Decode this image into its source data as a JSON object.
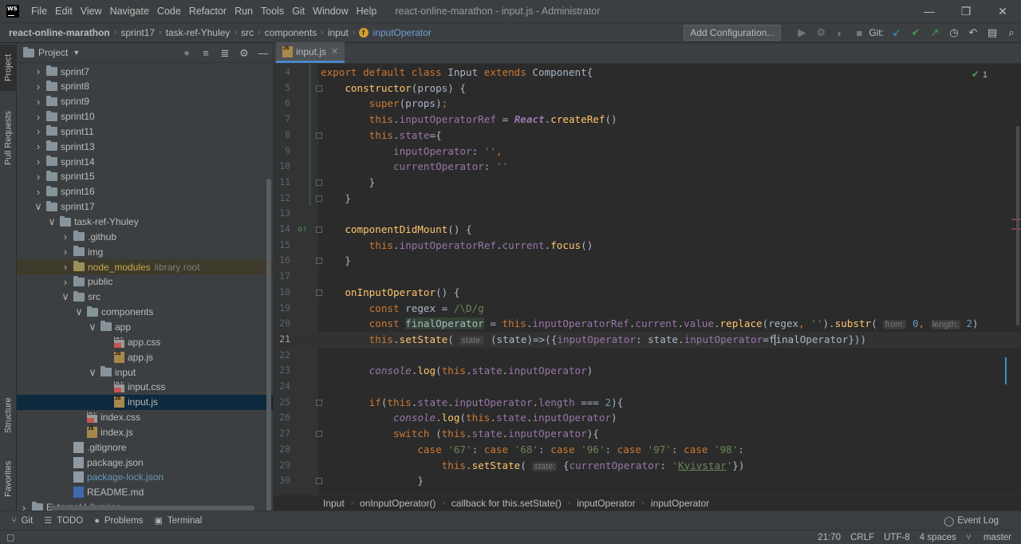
{
  "window": {
    "logo_text": "WS",
    "menu": [
      "File",
      "Edit",
      "View",
      "Navigate",
      "Code",
      "Refactor",
      "Run",
      "Tools",
      "Git",
      "Window",
      "Help"
    ],
    "title": "react-online-marathon - input.js - Administrator"
  },
  "nav": {
    "crumbs": [
      "react-online-marathon",
      "sprint17",
      "task-ref-Yhuley",
      "src",
      "components",
      "input"
    ],
    "function": "inputOperator",
    "add_config": "Add Configuration...",
    "git_label": "Git:"
  },
  "left_strip": {
    "project": "Project",
    "pull_requests": "Pull Requests",
    "structure": "Structure",
    "favorites": "Favorites"
  },
  "project_panel": {
    "title": "Project",
    "tree": [
      {
        "indent": 0,
        "arrow": "›",
        "type": "folder",
        "name": "sprint7"
      },
      {
        "indent": 0,
        "arrow": "›",
        "type": "folder",
        "name": "sprint8"
      },
      {
        "indent": 0,
        "arrow": "›",
        "type": "folder",
        "name": "sprint9"
      },
      {
        "indent": 0,
        "arrow": "›",
        "type": "folder",
        "name": "sprint10"
      },
      {
        "indent": 0,
        "arrow": "›",
        "type": "folder",
        "name": "sprint11"
      },
      {
        "indent": 0,
        "arrow": "›",
        "type": "folder",
        "name": "sprint13"
      },
      {
        "indent": 0,
        "arrow": "›",
        "type": "folder",
        "name": "sprint14"
      },
      {
        "indent": 0,
        "arrow": "›",
        "type": "folder",
        "name": "sprint15"
      },
      {
        "indent": 0,
        "arrow": "›",
        "type": "folder",
        "name": "sprint16"
      },
      {
        "indent": 0,
        "arrow": "⌄",
        "type": "folder",
        "name": "sprint17"
      },
      {
        "indent": 1,
        "arrow": "⌄",
        "type": "folder",
        "name": "task-ref-Yhuley"
      },
      {
        "indent": 2,
        "arrow": "›",
        "type": "folder",
        "name": ".github"
      },
      {
        "indent": 2,
        "arrow": "›",
        "type": "folder",
        "name": "img"
      },
      {
        "indent": 2,
        "arrow": "›",
        "type": "libfolder",
        "name": "node_modules",
        "extra": "library root"
      },
      {
        "indent": 2,
        "arrow": "›",
        "type": "folder",
        "name": "public"
      },
      {
        "indent": 2,
        "arrow": "⌄",
        "type": "folder",
        "name": "src"
      },
      {
        "indent": 3,
        "arrow": "⌄",
        "type": "folder",
        "name": "components"
      },
      {
        "indent": 4,
        "arrow": "⌄",
        "type": "folder",
        "name": "app"
      },
      {
        "indent": 5,
        "arrow": "",
        "type": "css",
        "name": "app.css"
      },
      {
        "indent": 5,
        "arrow": "",
        "type": "js",
        "name": "app.js"
      },
      {
        "indent": 4,
        "arrow": "⌄",
        "type": "folder",
        "name": "input"
      },
      {
        "indent": 5,
        "arrow": "",
        "type": "css",
        "name": "input.css"
      },
      {
        "indent": 5,
        "arrow": "",
        "type": "js",
        "name": "input.js",
        "selected": true
      },
      {
        "indent": 3,
        "arrow": "",
        "type": "css",
        "name": "index.css"
      },
      {
        "indent": 3,
        "arrow": "",
        "type": "js",
        "name": "index.js"
      },
      {
        "indent": 2,
        "arrow": "",
        "type": "git",
        "name": ".gitignore"
      },
      {
        "indent": 2,
        "arrow": "",
        "type": "json",
        "name": "package.json"
      },
      {
        "indent": 2,
        "arrow": "",
        "type": "json",
        "name": "package-lock.json",
        "blue": true
      },
      {
        "indent": 2,
        "arrow": "",
        "type": "md",
        "name": "README.md"
      },
      {
        "indent": -1,
        "arrow": "›",
        "type": "extlib",
        "name": "External Libraries"
      }
    ]
  },
  "editor": {
    "tab_label": "input.js",
    "inspection_count": "1",
    "breadcrumbs": [
      "Input",
      "onInputOperator()",
      "callback for this.setState()",
      "inputOperator",
      "inputOperator"
    ],
    "current_line": 21,
    "lines": [
      {
        "n": 4,
        "html": "<span class='kw'>export default class </span><span class='cls'>Input </span><span class='kw'>extends </span><span class='cls'>Component</span><span class='plain'>{</span>"
      },
      {
        "n": 5,
        "html": "    <span class='fn'>constructor</span><span class='plain'>(props) {</span>"
      },
      {
        "n": 6,
        "html": "        <span class='kw'>super</span><span class='plain'>(props)</span><span class='kw'>;</span>"
      },
      {
        "n": 7,
        "html": "        <span class='kw'>this</span><span class='plain'>.</span><span class='fld'>inputOperatorRef</span><span class='plain'> = </span><span class='ital'>React</span><span class='plain'>.</span><span class='fn'>createRef</span><span class='plain'>()</span>"
      },
      {
        "n": 8,
        "html": "        <span class='kw'>this</span><span class='plain'>.</span><span class='fld'>state</span><span class='plain'>={</span>"
      },
      {
        "n": 9,
        "html": "            <span class='fld'>inputOperator</span><span class='plain'>: </span><span class='str'>''</span><span class='kw'>,</span>"
      },
      {
        "n": 10,
        "html": "            <span class='fld'>currentOperator</span><span class='plain'>: </span><span class='str'>''</span>"
      },
      {
        "n": 11,
        "html": "        <span class='plain'>}</span>"
      },
      {
        "n": 12,
        "html": "    <span class='plain'>}</span>"
      },
      {
        "n": 13,
        "html": ""
      },
      {
        "n": 14,
        "html": "    <span class='fn'>componentDidMount</span><span class='plain'>() {</span>"
      },
      {
        "n": 15,
        "html": "        <span class='kw'>this</span><span class='plain'>.</span><span class='fld'>inputOperatorRef</span><span class='plain'>.</span><span class='fld'>current</span><span class='plain'>.</span><span class='fn'>focus</span><span class='plain'>()</span>"
      },
      {
        "n": 16,
        "html": "    <span class='plain'>}</span>"
      },
      {
        "n": 17,
        "html": ""
      },
      {
        "n": 18,
        "html": "    <span class='fn'>onInputOperator</span><span class='plain'>() {</span>"
      },
      {
        "n": 19,
        "html": "        <span class='kw'>const </span><span class='plain'>regex = </span><span class='str'>/\\D/g</span>"
      },
      {
        "n": 20,
        "html": "        <span class='kw'>const </span><span class='plain hl-var'>finalOperator</span><span class='plain'> = </span><span class='kw'>this</span><span class='plain'>.</span><span class='fld'>inputOperatorRef</span><span class='plain'>.</span><span class='fld'>current</span><span class='plain'>.</span><span class='fld'>value</span><span class='plain'>.</span><span class='fn'>replace</span><span class='plain'>(regex</span><span class='kw'>, </span><span class='str'>''</span><span class='plain'>).</span><span class='fn'>substr</span><span class='plain'>( </span><span class='param-hint'>from:</span><span class='num'> 0</span><span class='kw'>, </span><span class='param-hint'>length:</span><span class='num'> 2</span><span class='plain'>)</span>"
      },
      {
        "n": 21,
        "html": "        <span class='kw'>this</span><span class='plain'>.</span><span class='fn'>setState</span><span class='plain'>( </span><span class='param-hint'>state:</span><span class='plain'> (state)=>({</span><span class='fld'>inputOperator</span><span class='plain'>: state.</span><span class='fld'>inputOperator</span><span class='plain'>=f</span><span class='caret'></span><span class='plain'>inalOperator})</span><span class='plain'>)</span>"
      },
      {
        "n": 22,
        "html": ""
      },
      {
        "n": 23,
        "html": "        <span class='ital' style='font-weight:normal'>console</span><span class='plain'>.</span><span class='fn'>log</span><span class='plain'>(</span><span class='kw'>this</span><span class='plain'>.</span><span class='fld'>state</span><span class='plain'>.</span><span class='fld'>inputOperator</span><span class='plain'>)</span>"
      },
      {
        "n": 24,
        "html": ""
      },
      {
        "n": 25,
        "html": "        <span class='kw'>if</span><span class='plain'>(</span><span class='kw'>this</span><span class='plain'>.</span><span class='fld'>state</span><span class='plain'>.</span><span class='fld'>inputOperator</span><span class='plain'>.</span><span class='fld'>length</span><span class='plain'> === </span><span class='num'>2</span><span class='plain'>){</span>"
      },
      {
        "n": 26,
        "html": "            <span class='ital' style='font-weight:normal'>console</span><span class='plain'>.</span><span class='fn'>log</span><span class='plain'>(</span><span class='kw'>this</span><span class='plain'>.</span><span class='fld'>state</span><span class='plain'>.</span><span class='fld'>inputOperator</span><span class='plain'>)</span>"
      },
      {
        "n": 27,
        "html": "            <span class='kw'>switch </span><span class='plain'>(</span><span class='kw'>this</span><span class='plain'>.</span><span class='fld'>state</span><span class='plain'>.</span><span class='fld'>inputOperator</span><span class='plain'>){</span>"
      },
      {
        "n": 28,
        "html": "                <span class='kw'>case </span><span class='str'>'67'</span><span class='plain'>: </span><span class='kw'>case </span><span class='str'>'68'</span><span class='plain'>: </span><span class='kw'>case </span><span class='str'>'96'</span><span class='plain'>: </span><span class='kw'>case </span><span class='str'>'97'</span><span class='plain'>: </span><span class='kw'>case </span><span class='str'>'98'</span><span class='plain'>:</span>"
      },
      {
        "n": 29,
        "html": "                    <span class='kw'>this</span><span class='plain'>.</span><span class='fn'>setState</span><span class='plain'>( </span><span class='param-hint'>state:</span><span class='plain'> {</span><span class='fld'>currentOperator</span><span class='plain'>: </span><span class='str'>'<span class=\"under\">Kyivstar</span>'</span><span class='plain'>})</span>"
      },
      {
        "n": 30,
        "html": "                <span class='plain'>}</span>"
      }
    ]
  },
  "bottom_tools": [
    {
      "icon": "git-icon",
      "glyph": "⑂",
      "label": "Git"
    },
    {
      "icon": "todo-icon",
      "glyph": "☰",
      "label": "TODO"
    },
    {
      "icon": "problems-icon",
      "glyph": "●",
      "label": "Problems"
    },
    {
      "icon": "terminal-icon",
      "glyph": "▣",
      "label": "Terminal"
    }
  ],
  "event_log": "Event Log",
  "status": {
    "position": "21:70",
    "line_sep": "CRLF",
    "encoding": "UTF-8",
    "indent": "4 spaces",
    "branch": "master"
  },
  "colors": {
    "accent": "#4a88c7",
    "selection": "#0d293e",
    "keyword": "#cc7832",
    "string": "#6a8759"
  }
}
